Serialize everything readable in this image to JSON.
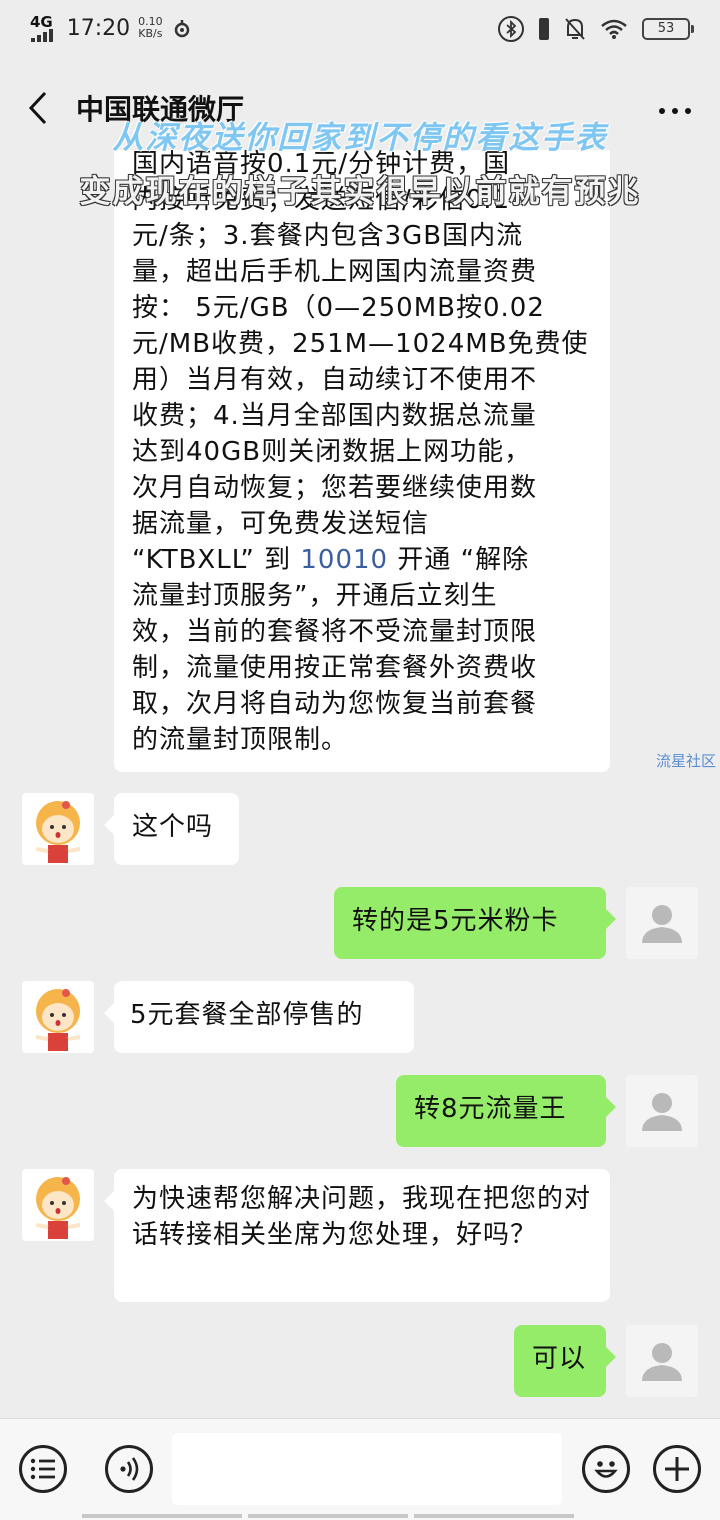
{
  "status_bar": {
    "network": "4G",
    "time": "17:20",
    "speed_value": "0.10",
    "speed_unit": "KB/s",
    "battery": "53"
  },
  "header": {
    "title": "中国联通微厅"
  },
  "overlay": {
    "line1": "从深夜送你回家到不停的看这手表",
    "line2": "变成现在的样子其实很早以前就有预兆"
  },
  "big_message": {
    "lines": [
      "国内语音按0.1元/分钟计费，国",
      "内接听免费；发送短信/彩信0.1",
      "元/条；3.套餐内包含3GB国内流",
      "量，超出后手机上网国内流量资费",
      "按： 5元/GB（0—250MB按0.02",
      "元/MB收费，251M—1024MB免费使",
      "用）当月有效，自动续订不使用不",
      "收费；4.当月全部国内数据总流量",
      "达到40GB则关闭数据上网功能，",
      "次月自动恢复；您若要继续使用数",
      "据流量，可免费发送短信"
    ],
    "line_kt_before": "“KTBXLL” 到 ",
    "line_kt_number": "10010",
    "line_kt_after": " 开通 “解除",
    "lines_after": [
      "流量封顶服务”，开通后立刻生",
      "效，当前的套餐将不受流量封顶限",
      "制，流量使用按正常套餐外资费收",
      "取，次月将自动为您恢复当前套餐",
      "的流量封顶限制。"
    ]
  },
  "watermark": "流星社区",
  "messages": [
    {
      "side": "left",
      "text": "这个吗"
    },
    {
      "side": "right",
      "text": "转的是5元米粉卡"
    },
    {
      "side": "left",
      "text": "5元套餐全部停售的"
    },
    {
      "side": "right",
      "text": "转8元流量王"
    },
    {
      "side": "left",
      "text": "为快速帮您解决问题，我现在把您的对话转接相关坐席为您处理，好吗？"
    },
    {
      "side": "right",
      "text": "可以"
    }
  ],
  "icons": {
    "back": "chevron-left-icon",
    "more": "more-dots-icon",
    "menu": "list-menu-icon",
    "voice": "voice-icon",
    "emoji": "emoji-icon",
    "add": "plus-icon"
  }
}
